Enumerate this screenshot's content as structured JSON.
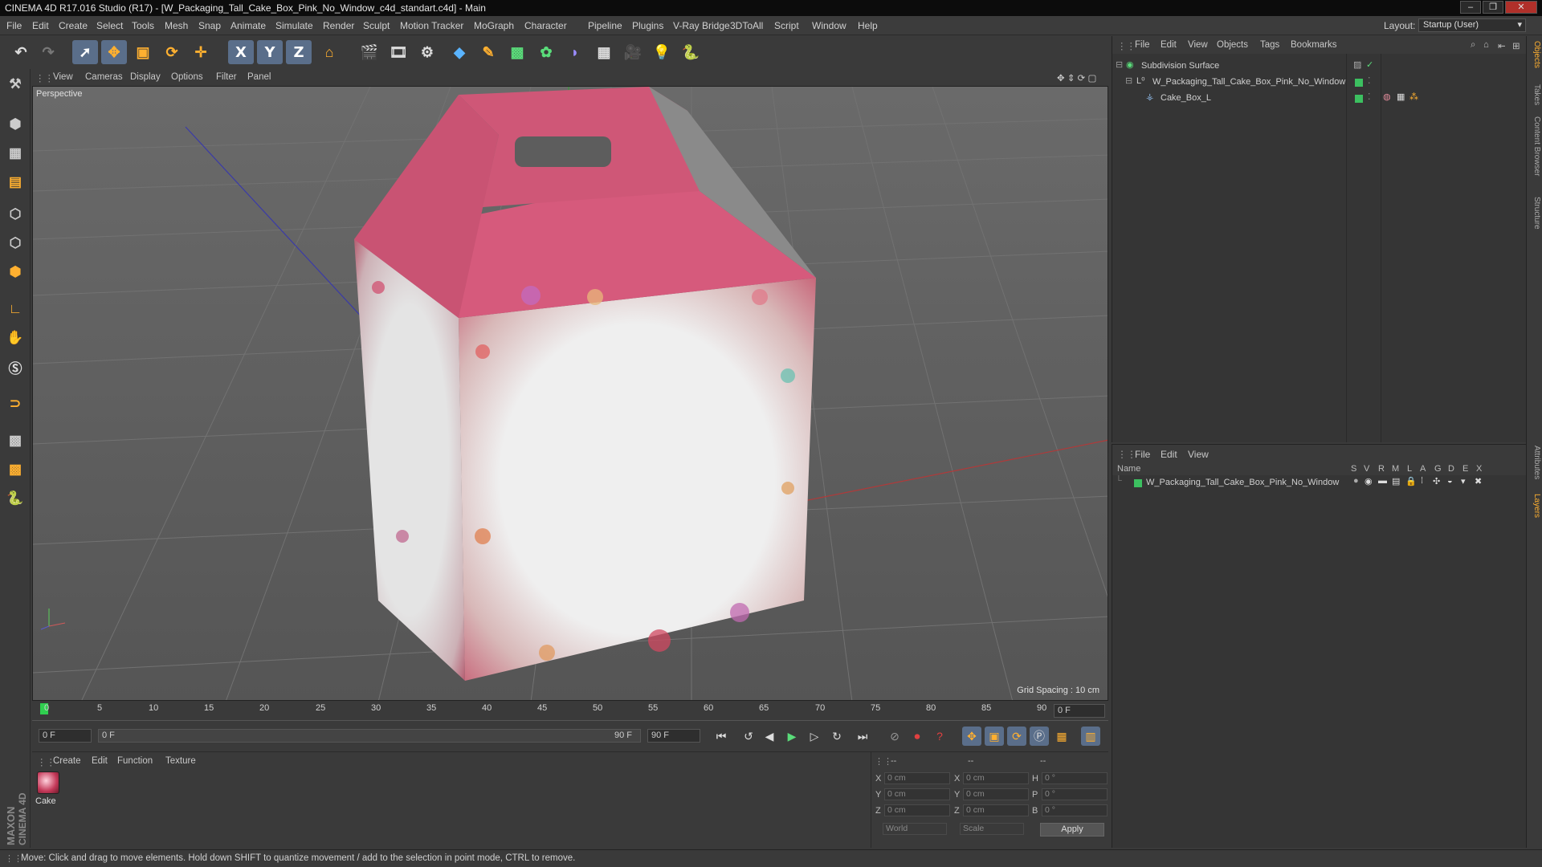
{
  "window": {
    "title": "CINEMA 4D R17.016 Studio (R17) - [W_Packaging_Tall_Cake_Box_Pink_No_Window_c4d_standart.c4d] - Main",
    "controls": [
      "–",
      "❐",
      "✕"
    ]
  },
  "menubar": {
    "items": [
      "File",
      "Edit",
      "Create",
      "Select",
      "Tools",
      "Mesh",
      "Snap",
      "Animate",
      "Simulate",
      "Render",
      "Sculpt",
      "Motion Tracker",
      "MoGraph",
      "Character",
      "Pipeline",
      "Plugins",
      "V-Ray Bridge",
      "3DToAll",
      "Script",
      "Window",
      "Help"
    ],
    "layout_label": "Layout:",
    "layout_value": "Startup (User)"
  },
  "toolbar": {
    "icons": [
      "undo-icon",
      "redo-icon",
      "select-arrow-icon",
      "move-icon",
      "scale-icon",
      "rotate-icon",
      "move-tool-icon",
      "x-axis-icon",
      "y-axis-icon",
      "z-axis-icon",
      "coordinate-system-icon",
      "render-view-icon",
      "render-picture-viewer-icon",
      "render-settings-icon",
      "cube-icon",
      "pen-spline-icon",
      "subdivision-icon",
      "array-icon",
      "deformer-icon",
      "floor-icon",
      "camera-icon",
      "light-icon",
      "python-icon"
    ],
    "axis_labels": [
      "X",
      "Y",
      "Z"
    ]
  },
  "viewport": {
    "menu": [
      "View",
      "Cameras",
      "Display",
      "Options",
      "Filter",
      "Panel"
    ],
    "name": "Perspective",
    "grid_spacing": "Grid Spacing : 10 cm"
  },
  "timeline": {
    "ticks": [
      "0",
      "5",
      "10",
      "15",
      "20",
      "25",
      "30",
      "35",
      "40",
      "45",
      "50",
      "55",
      "60",
      "65",
      "70",
      "75",
      "80",
      "85",
      "90"
    ],
    "current_frame": "0 F"
  },
  "transport": {
    "start_field": "0 F",
    "range_start": "0 F",
    "range_end": "90 F",
    "end_field": "90 F"
  },
  "material_manager": {
    "menu": [
      "Create",
      "Edit",
      "Function",
      "Texture"
    ],
    "materials": [
      {
        "name": "Cake"
      }
    ]
  },
  "coordinates": {
    "header": [
      "--",
      "--",
      "--"
    ],
    "rows": [
      {
        "a": "X",
        "av": "0 cm",
        "b": "X",
        "bv": "0 cm",
        "c": "H",
        "cv": "0 °"
      },
      {
        "a": "Y",
        "av": "0 cm",
        "b": "Y",
        "bv": "0 cm",
        "c": "P",
        "cv": "0 °"
      },
      {
        "a": "Z",
        "av": "0 cm",
        "b": "Z",
        "bv": "0 cm",
        "c": "B",
        "cv": "0 °"
      }
    ],
    "mode": "World",
    "type": "Scale",
    "apply": "Apply"
  },
  "object_manager": {
    "menu": [
      "File",
      "Edit",
      "View",
      "Objects",
      "Tags",
      "Bookmarks"
    ],
    "objects": [
      {
        "name": "Subdivision Surface",
        "depth": 0
      },
      {
        "name": "W_Packaging_Tall_Cake_Box_Pink_No_Window",
        "depth": 1
      },
      {
        "name": "Cake_Box_L",
        "depth": 2
      }
    ]
  },
  "layer_manager": {
    "menu": [
      "File",
      "Edit",
      "View"
    ],
    "columns": [
      "Name",
      "S",
      "V",
      "R",
      "M",
      "L",
      "A",
      "G",
      "D",
      "E",
      "X"
    ],
    "layers": [
      {
        "name": "W_Packaging_Tall_Cake_Box_Pink_No_Window",
        "color": "#3cc060"
      }
    ]
  },
  "right_tabs": [
    "Objects",
    "Takes",
    "Content Browser",
    "Structure",
    "Attributes",
    "Layers"
  ],
  "status": {
    "text": "Move: Click and drag to move elements. Hold down SHIFT to quantize movement / add to the selection in point mode, CTRL to remove."
  },
  "brand": {
    "logo_text": "MAXON CINEMA 4D"
  },
  "colors": {
    "accent_blue": "#5a6e8a",
    "box_pink": "#d65a7c",
    "layer_green": "#3cc060",
    "timeline_marker": "#2fcf4f"
  }
}
